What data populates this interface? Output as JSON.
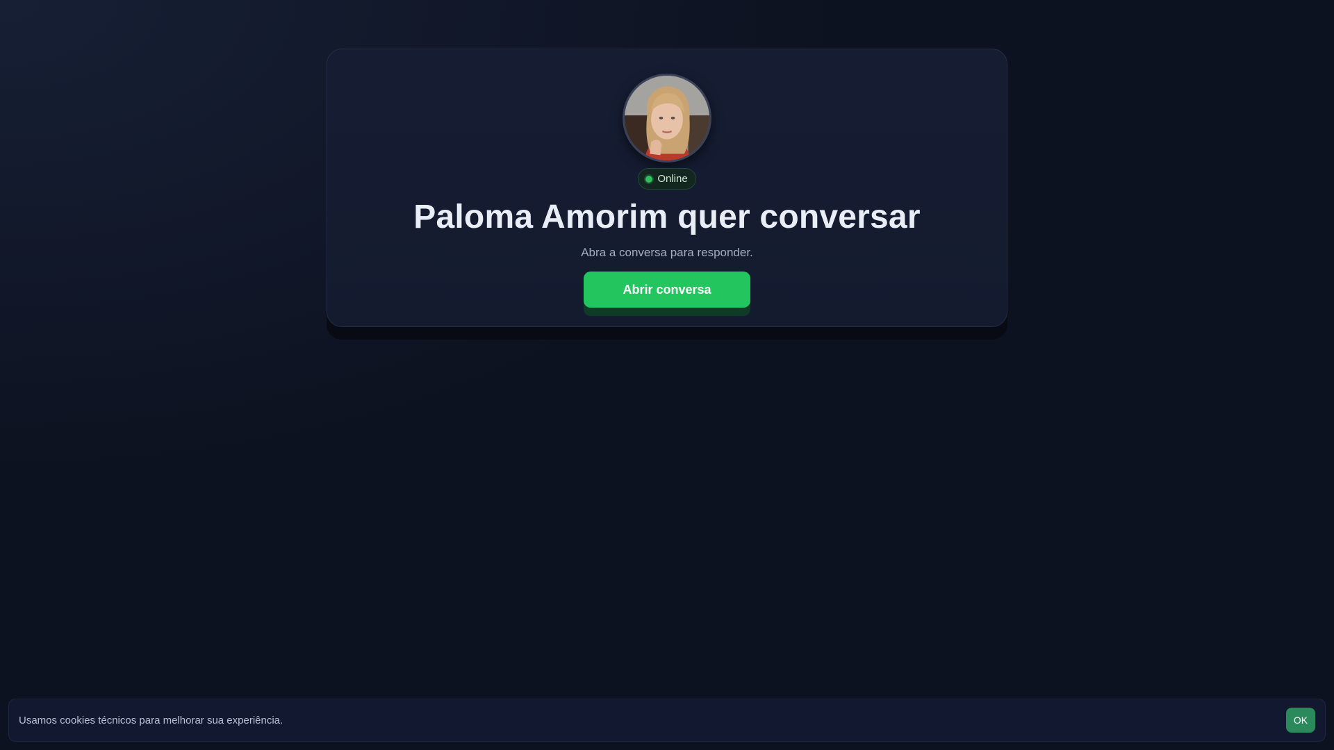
{
  "profile": {
    "name_heading": "Paloma Amorim quer conversar",
    "status": "Online",
    "subtitle": "Abra a conversa para responder.",
    "cta_label": "Abrir conversa"
  },
  "cookie_banner": {
    "text": "Usamos cookies técnicos para melhorar sua experiência.",
    "ok_label": "OK"
  },
  "colors": {
    "background": "#0d1220",
    "card": "#151c31",
    "accent": "#22c55e",
    "status_dot": "#2fbf5f",
    "cookie_button": "#2b8a5c"
  },
  "icons": {
    "status": "status-dot-icon"
  }
}
